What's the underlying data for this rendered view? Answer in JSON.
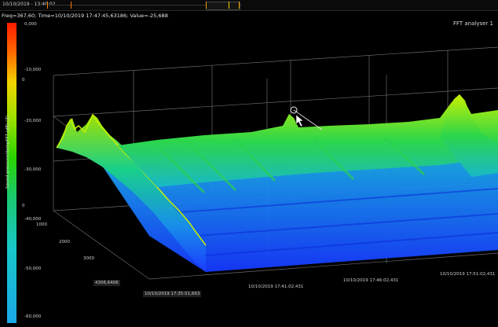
{
  "timeline": {
    "start_date": "10/10/2019 - 13:40:02"
  },
  "readout": "Freq=367,60; Time=10/10/2019 17:47:45,63186; Value=-25,688",
  "panel_title": "FFT analyser 1",
  "colorbar": {
    "label": "Sound pressure/dampFFT (dB) (Z)",
    "ticks": [
      "0,000",
      "-10,000",
      "-20,000",
      "-30,000",
      "-40,000",
      "-50,000",
      "-60,000"
    ]
  },
  "z_axis_ticks": [
    "0",
    "0"
  ],
  "y_axis_ticks": [
    "1000",
    "2000",
    "3000"
  ],
  "y_axis_value": "4306,6406",
  "time_axis": {
    "start": "10/10/2019 17:35:51,663",
    "ticks": [
      "10/10/2019 17:41:02,431",
      "10/10/2019 17:46:02,431",
      "10/10/2019 17:51:02,431"
    ]
  },
  "colors": {
    "low": "#1a3cff",
    "mid": "#19c8d0",
    "high": "#7ee000",
    "peak": "#ff1a00"
  }
}
